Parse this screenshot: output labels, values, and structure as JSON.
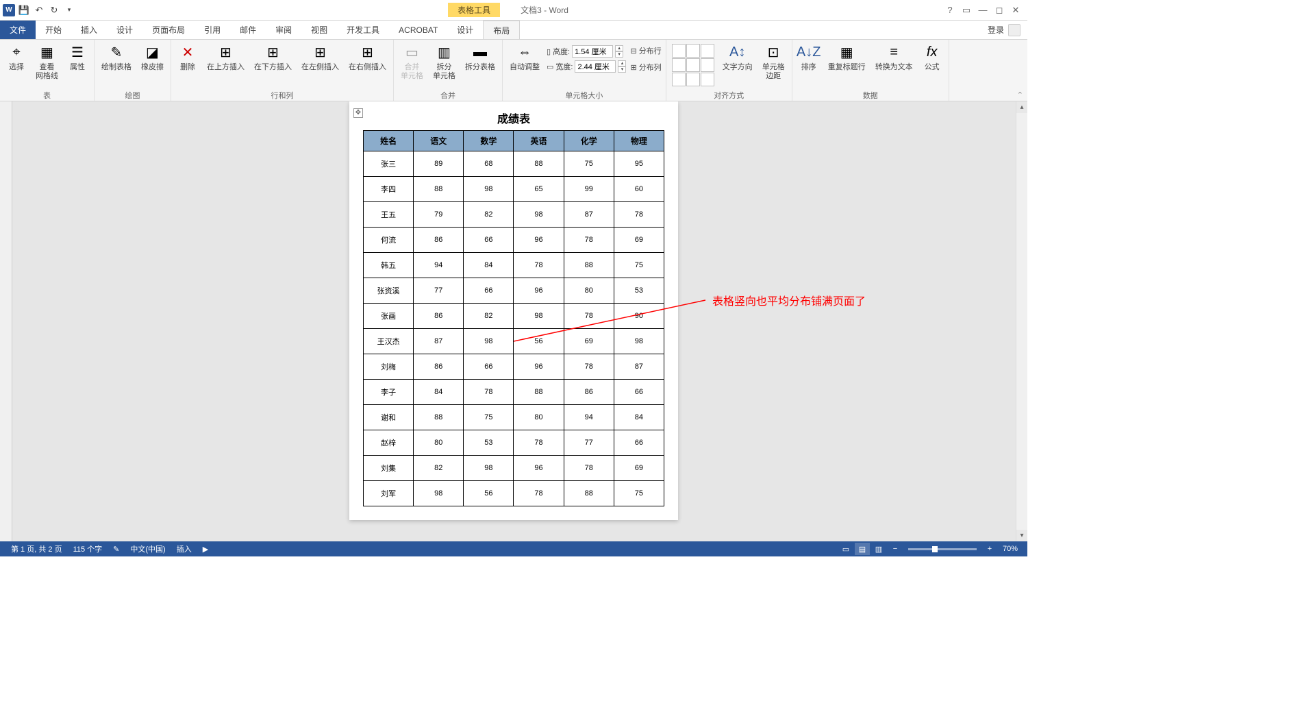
{
  "titlebar": {
    "context_tool": "表格工具",
    "doc_title": "文档3 - Word",
    "help": "?",
    "login": "登录"
  },
  "tabs": {
    "file": "文件",
    "items": [
      "开始",
      "插入",
      "设计",
      "页面布局",
      "引用",
      "邮件",
      "审阅",
      "视图",
      "开发工具",
      "ACROBAT"
    ],
    "context_design": "设计",
    "context_layout": "布局"
  },
  "ribbon": {
    "g_table": {
      "label": "表",
      "select": "选择",
      "view_grid": "查看\n网格线",
      "props": "属性"
    },
    "g_draw": {
      "label": "绘图",
      "draw": "绘制表格",
      "eraser": "橡皮擦"
    },
    "g_rowcol": {
      "label": "行和列",
      "delete": "删除",
      "ins_above": "在上方插入",
      "ins_below": "在下方插入",
      "ins_left": "在左侧插入",
      "ins_right": "在右侧插入"
    },
    "g_merge": {
      "label": "合并",
      "merge": "合并\n单元格",
      "split": "拆分\n单元格",
      "split_tbl": "拆分表格"
    },
    "g_size": {
      "label": "单元格大小",
      "autofit": "自动调整",
      "height_lbl": "高度:",
      "height_val": "1.54 厘米",
      "width_lbl": "宽度:",
      "width_val": "2.44 厘米",
      "dist_row": "分布行",
      "dist_col": "分布列"
    },
    "g_align": {
      "label": "对齐方式",
      "text_dir": "文字方向",
      "cell_margin": "单元格\n边距"
    },
    "g_data": {
      "label": "数据",
      "sort": "排序",
      "repeat_header": "重复标题行",
      "to_text": "转换为文本",
      "formula": "公式"
    }
  },
  "document": {
    "title": "成绩表",
    "headers": [
      "姓名",
      "语文",
      "数学",
      "英语",
      "化学",
      "物理"
    ],
    "rows": [
      [
        "张三",
        "89",
        "68",
        "88",
        "75",
        "95"
      ],
      [
        "李四",
        "88",
        "98",
        "65",
        "99",
        "60"
      ],
      [
        "王五",
        "79",
        "82",
        "98",
        "87",
        "78"
      ],
      [
        "何流",
        "86",
        "66",
        "96",
        "78",
        "69"
      ],
      [
        "韩五",
        "94",
        "84",
        "78",
        "88",
        "75"
      ],
      [
        "张资溪",
        "77",
        "66",
        "96",
        "80",
        "53"
      ],
      [
        "张画",
        "86",
        "82",
        "98",
        "78",
        "90"
      ],
      [
        "王汉杰",
        "87",
        "98",
        "56",
        "69",
        "98"
      ],
      [
        "刘梅",
        "86",
        "66",
        "96",
        "78",
        "87"
      ],
      [
        "李子",
        "84",
        "78",
        "88",
        "86",
        "66"
      ],
      [
        "谢和",
        "88",
        "75",
        "80",
        "94",
        "84"
      ],
      [
        "赵梓",
        "80",
        "53",
        "78",
        "77",
        "66"
      ],
      [
        "刘集",
        "82",
        "98",
        "96",
        "78",
        "69"
      ],
      [
        "刘军",
        "98",
        "56",
        "78",
        "88",
        "75"
      ]
    ]
  },
  "annotation": "表格竖向也平均分布铺满页面了",
  "statusbar": {
    "page": "第 1 页, 共 2 页",
    "words": "115 个字",
    "lang": "中文(中国)",
    "mode": "插入",
    "zoom": "70%"
  }
}
